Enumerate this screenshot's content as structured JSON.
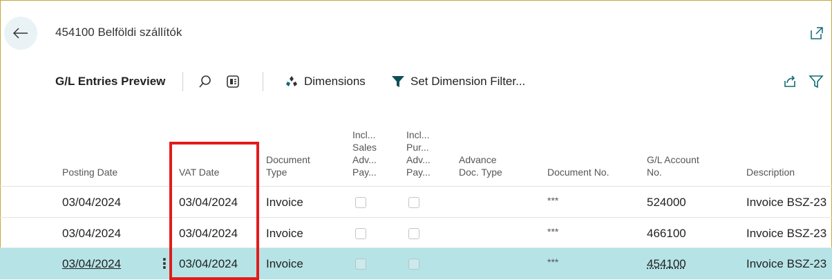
{
  "header": {
    "title": "454100 Belföldi szállítók"
  },
  "toolbar": {
    "title": "G/L Entries Preview",
    "dimensions_label": "Dimensions",
    "set_dimension_filter_label": "Set Dimension Filter..."
  },
  "columns": {
    "posting_date": "Posting Date",
    "vat_date": "VAT Date",
    "document_type_1": "Document",
    "document_type_2": "Type",
    "incl_sales_1": "Incl...",
    "incl_sales_2": "Sales",
    "incl_sales_3": "Adv...",
    "incl_sales_4": "Pay...",
    "incl_pur_1": "Incl...",
    "incl_pur_2": "Pur...",
    "incl_pur_3": "Adv...",
    "incl_pur_4": "Pay...",
    "advance_doc_type_1": "Advance",
    "advance_doc_type_2": "Doc. Type",
    "document_no": "Document No.",
    "gl_account_no_1": "G/L Account",
    "gl_account_no_2": "No.",
    "description": "Description"
  },
  "rows": [
    {
      "posting_date": "03/04/2024",
      "vat_date": "03/04/2024",
      "document_type": "Invoice",
      "document_no": "***",
      "gl_account_no": "524000",
      "description": "Invoice BSZ-23"
    },
    {
      "posting_date": "03/04/2024",
      "vat_date": "03/04/2024",
      "document_type": "Invoice",
      "document_no": "***",
      "gl_account_no": "466100",
      "description": "Invoice BSZ-23"
    },
    {
      "posting_date": "03/04/2024",
      "vat_date": "03/04/2024",
      "document_type": "Invoice",
      "document_no": "***",
      "gl_account_no": "454100",
      "description": "Invoice BSZ-23"
    }
  ],
  "colors": {
    "selected_row": "#b6e3e6",
    "highlight_box": "#e21b1b",
    "accent": "#0e7c86"
  }
}
